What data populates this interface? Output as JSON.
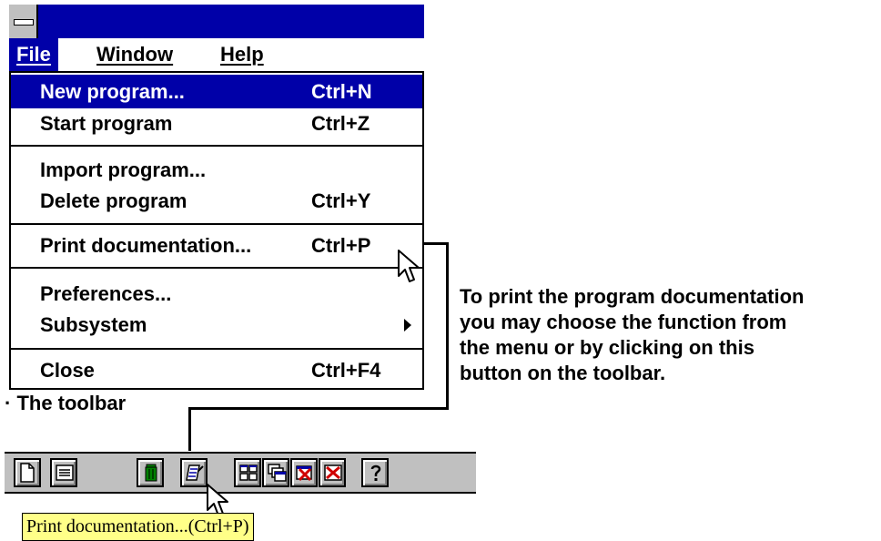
{
  "window": {
    "system_menu_icon": "system-menu-bar"
  },
  "menubar": {
    "items": [
      {
        "label": "File",
        "active": true
      },
      {
        "label": "Window",
        "active": false
      },
      {
        "label": "Help",
        "active": false
      }
    ]
  },
  "file_menu": {
    "items": [
      {
        "label": "New program...",
        "shortcut": "Ctrl+N",
        "highlighted": true
      },
      {
        "label": "Start program",
        "shortcut": "Ctrl+Z"
      },
      {
        "label": "Import program...",
        "shortcut": ""
      },
      {
        "label": "Delete program",
        "shortcut": "Ctrl+Y"
      },
      {
        "label": "Print documentation...",
        "shortcut": "Ctrl+P"
      },
      {
        "label": "Preferences...",
        "shortcut": ""
      },
      {
        "label": "Subsystem",
        "shortcut": "",
        "submenu": true
      },
      {
        "label": "Close",
        "shortcut": "Ctrl+F4"
      }
    ]
  },
  "caption": "· The toolbar",
  "callout": {
    "lines": [
      "To print the program documentation",
      "you may choose the function from",
      "the menu or by clicking on this",
      "button on the toolbar."
    ]
  },
  "toolbar": {
    "buttons": [
      {
        "icon": "new-document-icon"
      },
      {
        "icon": "list-icon"
      },
      {
        "icon": "trash-icon"
      },
      {
        "icon": "print-documentation-icon"
      },
      {
        "icon": "tile-windows-icon"
      },
      {
        "icon": "cascade-windows-icon"
      },
      {
        "icon": "close-window-icon"
      },
      {
        "icon": "close-all-icon"
      },
      {
        "icon": "help-icon"
      }
    ]
  },
  "tooltip": "Print documentation...(Ctrl+P)",
  "colors": {
    "titlebar": "#0000a8",
    "highlight": "#0000a8",
    "toolbar": "#c0c0c0",
    "tooltip": "#ffff88"
  }
}
